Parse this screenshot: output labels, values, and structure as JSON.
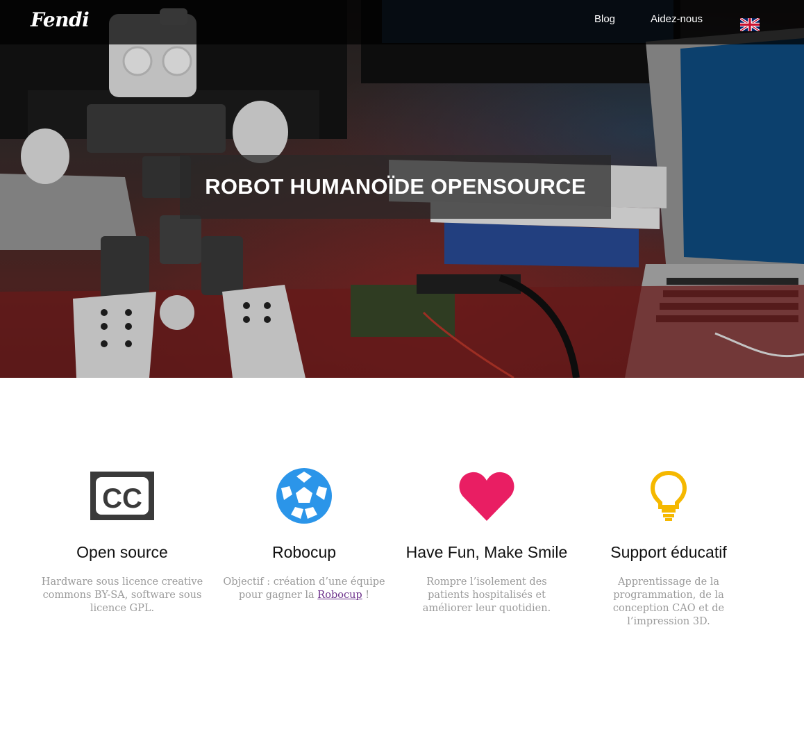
{
  "navbar": {
    "brand": "Fendi",
    "links": [
      {
        "label": "Blog"
      },
      {
        "label": "Aidez-nous"
      }
    ],
    "language_flag": "uk-flag-icon"
  },
  "hero": {
    "title": "ROBOT HUMANOÏDE OPENSOURCE"
  },
  "features": [
    {
      "icon": "creative-commons-icon",
      "icon_color": "#3a3a3a",
      "title": "Open source",
      "text": "Hardware sous licence creative commons BY-SA, software sous licence GPL."
    },
    {
      "icon": "soccer-ball-icon",
      "icon_color": "#2b95e9",
      "title": "Robocup",
      "text_before": "Objectif : création d’une équipe pour gagner la ",
      "link": "Robocup",
      "text_after": " !"
    },
    {
      "icon": "heart-icon",
      "icon_color": "#e91e63",
      "title": "Have Fun, Make Smile",
      "text": "Rompre l’isolement des patients hospitalisés et améliorer leur quotidien."
    },
    {
      "icon": "lightbulb-icon",
      "icon_color": "#f5b800",
      "title": "Support éducatif",
      "text": "Apprentissage de la programmation, de la conception CAO et de l’impression 3D."
    }
  ]
}
